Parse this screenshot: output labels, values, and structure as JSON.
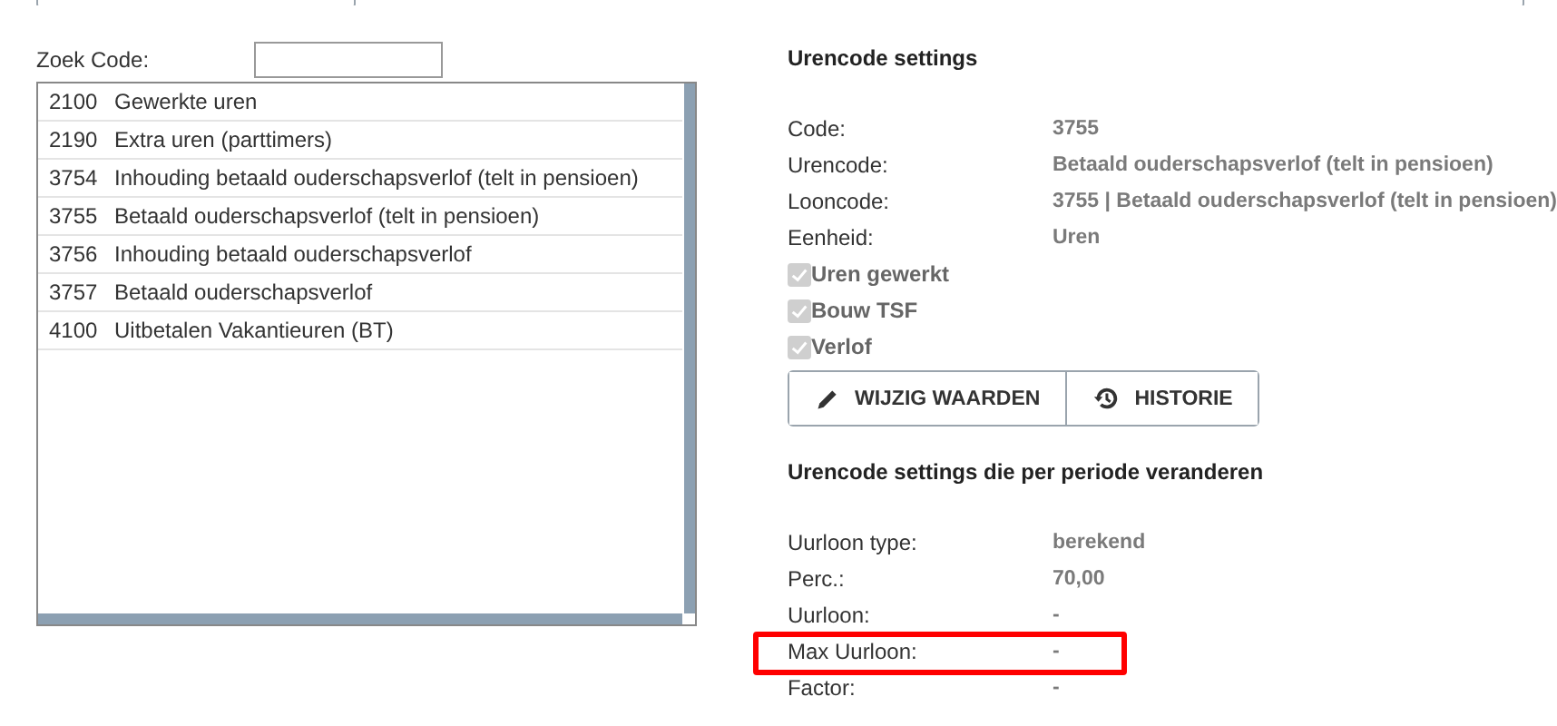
{
  "search": {
    "label": "Zoek Code:"
  },
  "codes": [
    {
      "code": "2100",
      "name": "Gewerkte uren"
    },
    {
      "code": "2190",
      "name": "Extra uren (parttimers)"
    },
    {
      "code": "3754",
      "name": "Inhouding betaald ouderschapsverlof (telt in pensioen)"
    },
    {
      "code": "3755",
      "name": "Betaald ouderschapsverlof (telt in pensioen)"
    },
    {
      "code": "3756",
      "name": "Inhouding betaald ouderschapsverlof"
    },
    {
      "code": "3757",
      "name": "Betaald ouderschapsverlof"
    },
    {
      "code": "4100",
      "name": "Uitbetalen Vakantieuren (BT)"
    }
  ],
  "settings": {
    "title": "Urencode settings",
    "fields": [
      {
        "label": "Code:",
        "value": "3755"
      },
      {
        "label": "Urencode:",
        "value": "Betaald ouderschapsverlof (telt in pensioen)"
      },
      {
        "label": "Looncode:",
        "value": "3755 | Betaald ouderschapsverlof (telt in pensioen)"
      },
      {
        "label": "Eenheid:",
        "value": "Uren"
      }
    ],
    "checkboxes": [
      {
        "label": "Uren gewerkt",
        "checked": true,
        "disabled": true
      },
      {
        "label": "Bouw TSF",
        "checked": true,
        "disabled": true
      },
      {
        "label": "Verlof",
        "checked": true,
        "disabled": true
      }
    ],
    "buttons": [
      {
        "kind": "edit",
        "label": "WIJZIG WAARDEN"
      },
      {
        "kind": "history",
        "label": "HISTORIE"
      }
    ]
  },
  "period_settings": {
    "title": "Urencode settings die per periode veranderen",
    "fields": [
      {
        "label": "Uurloon type:",
        "value": "berekend",
        "highlighted": false
      },
      {
        "label": "Perc.:",
        "value": "70,00",
        "highlighted": false
      },
      {
        "label": "Uurloon:",
        "value": "-",
        "highlighted": false
      },
      {
        "label": "Max Uurloon:",
        "value": "-",
        "highlighted": true
      },
      {
        "label": "Factor:",
        "value": "-",
        "highlighted": false
      }
    ]
  }
}
